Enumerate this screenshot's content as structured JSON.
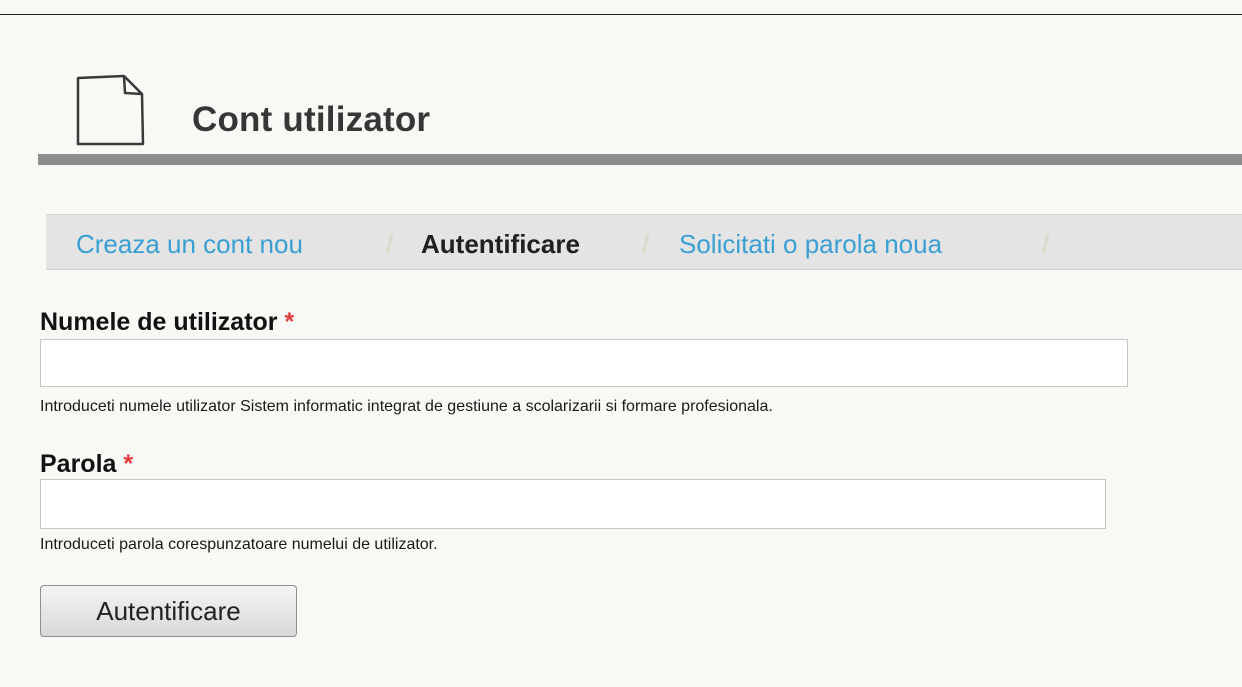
{
  "header": {
    "icon": "document-page-icon",
    "title": "Cont utilizator"
  },
  "tabs": [
    {
      "label": "Creaza un cont nou",
      "active": false
    },
    {
      "label": "Autentificare",
      "active": true
    },
    {
      "label": "Solicitati o parola noua",
      "active": false
    }
  ],
  "tab_separator": "/",
  "form": {
    "required_marker": "*",
    "username": {
      "label": "Numele de utilizator",
      "value": "",
      "help": "Introduceti numele utilizator Sistem informatic integrat de gestiune a scolarizarii si formare profesionala."
    },
    "password": {
      "label": "Parola",
      "value": "",
      "help": "Introduceti parola corespunzatoare numelui de utilizator."
    },
    "submit_label": "Autentificare"
  }
}
